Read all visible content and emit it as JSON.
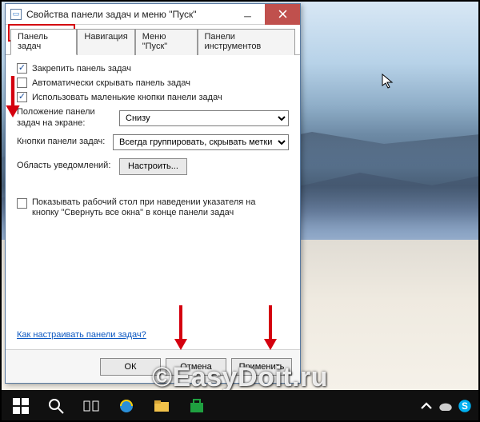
{
  "window": {
    "title": "Свойства панели задач и меню \"Пуск\""
  },
  "tabs": {
    "taskbar": "Панель задач",
    "navigation": "Навигация",
    "startmenu": "Меню \"Пуск\"",
    "toolbars": "Панели инструментов"
  },
  "options": {
    "lock": "Закрепить панель задач",
    "autohide": "Автоматически скрывать панель задач",
    "smallbuttons": "Использовать маленькие кнопки панели задач"
  },
  "position": {
    "label": "Положение панели задач на экране:",
    "value": "Снизу"
  },
  "buttons_group": {
    "label": "Кнопки панели задач:",
    "value": "Всегда группировать, скрывать метки"
  },
  "notification_area": {
    "label": "Область уведомлений:",
    "button": "Настроить..."
  },
  "show_desktop": {
    "label": "Показывать рабочий стол при наведении указателя на кнопку \"Свернуть все окна\" в конце панели задач"
  },
  "help_link": "Как настраивать панели задач?",
  "dialog_buttons": {
    "ok": "ОК",
    "cancel": "Отмена",
    "apply": "Применить"
  },
  "watermark": "©EasyDoit.ru"
}
